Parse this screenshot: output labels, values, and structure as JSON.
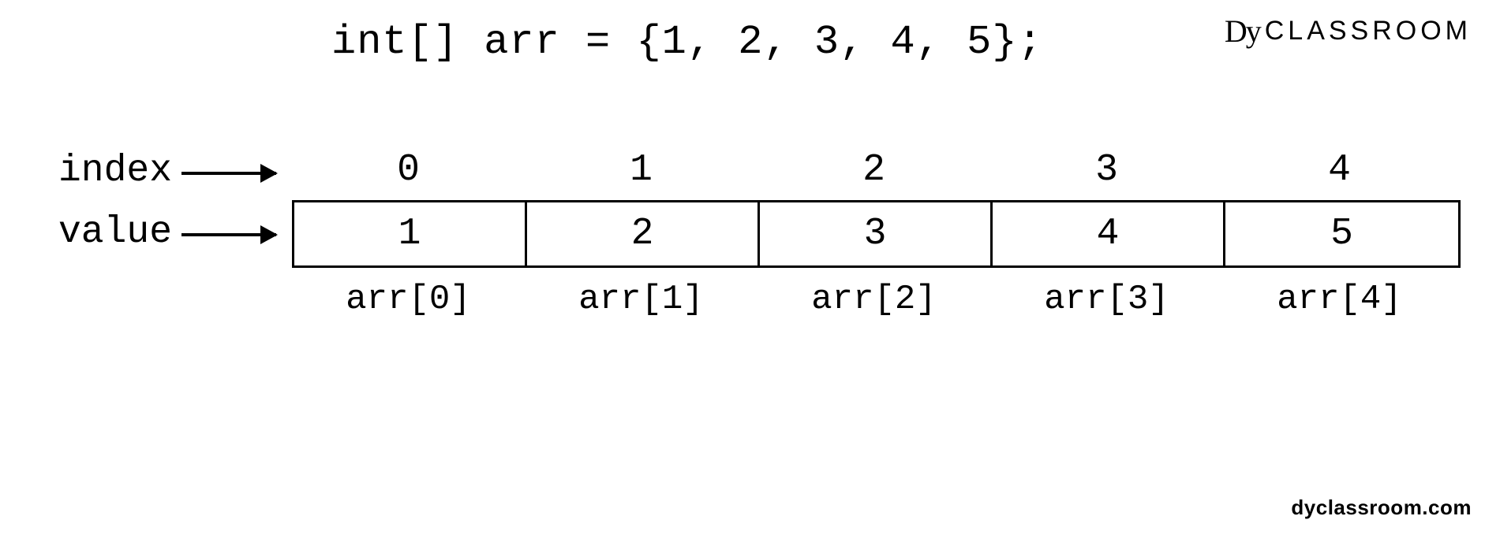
{
  "code": "int[] arr = {1, 2, 3, 4, 5};",
  "brand": {
    "mark": "Dy",
    "name": "CLASSROOM"
  },
  "labels": {
    "index": "index",
    "value": "value"
  },
  "array": {
    "indices": [
      "0",
      "1",
      "2",
      "3",
      "4"
    ],
    "values": [
      "1",
      "2",
      "3",
      "4",
      "5"
    ],
    "access": [
      "arr[0]",
      "arr[1]",
      "arr[2]",
      "arr[3]",
      "arr[4]"
    ]
  },
  "footer": "dyclassroom.com",
  "chart_data": {
    "type": "diagram",
    "description": "Java int array declaration with index/value visualization",
    "declaration": "int[] arr = {1, 2, 3, 4, 5};",
    "cells": [
      {
        "index": 0,
        "value": 1,
        "access": "arr[0]"
      },
      {
        "index": 1,
        "value": 2,
        "access": "arr[1]"
      },
      {
        "index": 2,
        "value": 3,
        "access": "arr[2]"
      },
      {
        "index": 3,
        "value": 4,
        "access": "arr[3]"
      },
      {
        "index": 4,
        "value": 5,
        "access": "arr[4]"
      }
    ]
  }
}
